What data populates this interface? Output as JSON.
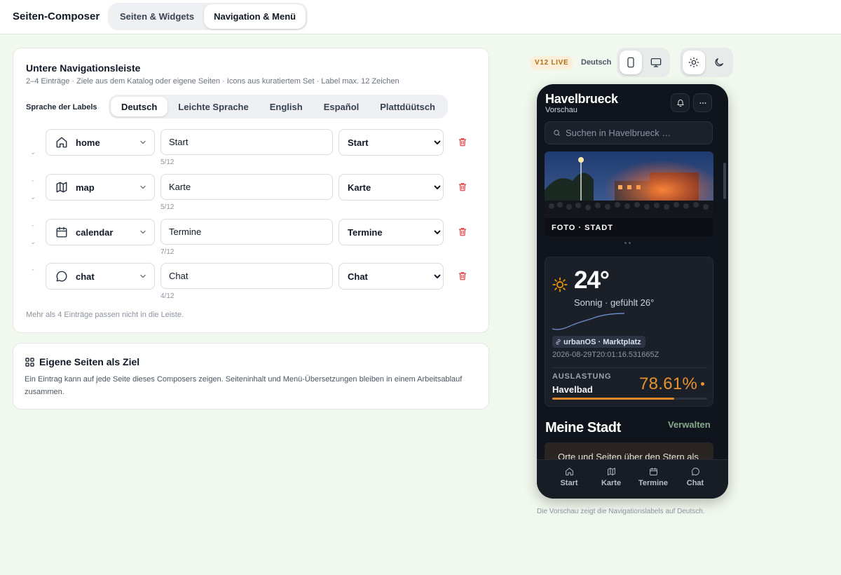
{
  "app": {
    "title": "Seiten-Composer"
  },
  "tabs": [
    {
      "label": "Seiten & Widgets",
      "active": false
    },
    {
      "label": "Navigation & Menü",
      "active": true
    }
  ],
  "nav_editor": {
    "title": "Untere Navigationsleiste",
    "subtitle": "2–4 Einträge · Ziele aus dem Katalog oder eigene Seiten · Icons aus kuratiertem Set · Label max. 12 Zeichen",
    "language_label": "Sprache der Labels",
    "languages": [
      {
        "label": "Deutsch",
        "active": true
      },
      {
        "label": "Leichte Sprache",
        "active": false
      },
      {
        "label": "English",
        "active": false
      },
      {
        "label": "Español",
        "active": false
      },
      {
        "label": "Plattdüütsch",
        "active": false
      }
    ],
    "entries": [
      {
        "icon": "home",
        "label": "Start",
        "count": "5/12",
        "target": "Start"
      },
      {
        "icon": "map",
        "label": "Karte",
        "count": "5/12",
        "target": "Karte"
      },
      {
        "icon": "calendar",
        "label": "Termine",
        "count": "7/12",
        "target": "Termine"
      },
      {
        "icon": "chat",
        "label": "Chat",
        "count": "4/12",
        "target": "Chat"
      }
    ],
    "limit_note": "Mehr als 4 Einträge passen nicht in die Leiste."
  },
  "custom_pages": {
    "icon": "grid-icon",
    "title": "Eigene Seiten als Ziel",
    "text": "Ein Eintrag kann auf jede Seite dieses Composers zeigen. Seiteninhalt und Menü-Übersetzungen bleiben in einem Arbeitsablauf zusammen."
  },
  "preview_toolbar": {
    "badge": "V12 LIVE",
    "language": "Deutsch",
    "device_active": "mobile",
    "theme_active": "light"
  },
  "phone": {
    "title": "Havelbrueck",
    "subtitle": "Vorschau",
    "search_placeholder": "Suchen in Havelbrueck …",
    "hero_label": "FOTO · STADT",
    "weather": {
      "temp": "24°",
      "condition": "Sonnig · gefühlt 26°",
      "source": "urbanOS · Marktplatz",
      "timestamp": "2026-08-29T20:01:16.531665Z",
      "utilization_label": "AUSLASTUNG",
      "place": "Havelbad",
      "percent": "78.61%",
      "fill_fraction": 0.7861
    },
    "section_title": "Meine Stadt",
    "section_action": "Verwalten",
    "teaser_text": "Orte und Seiten über den Stern als",
    "nav": [
      "Start",
      "Karte",
      "Termine",
      "Chat"
    ]
  },
  "preview_note": "Die Vorschau zeigt die Navigationslabels auf Deutsch.",
  "colors": {
    "accent": "#e89230",
    "danger": "#dc2626",
    "page_bg": "#f1f8ee",
    "phone_bg": "#10141c"
  }
}
